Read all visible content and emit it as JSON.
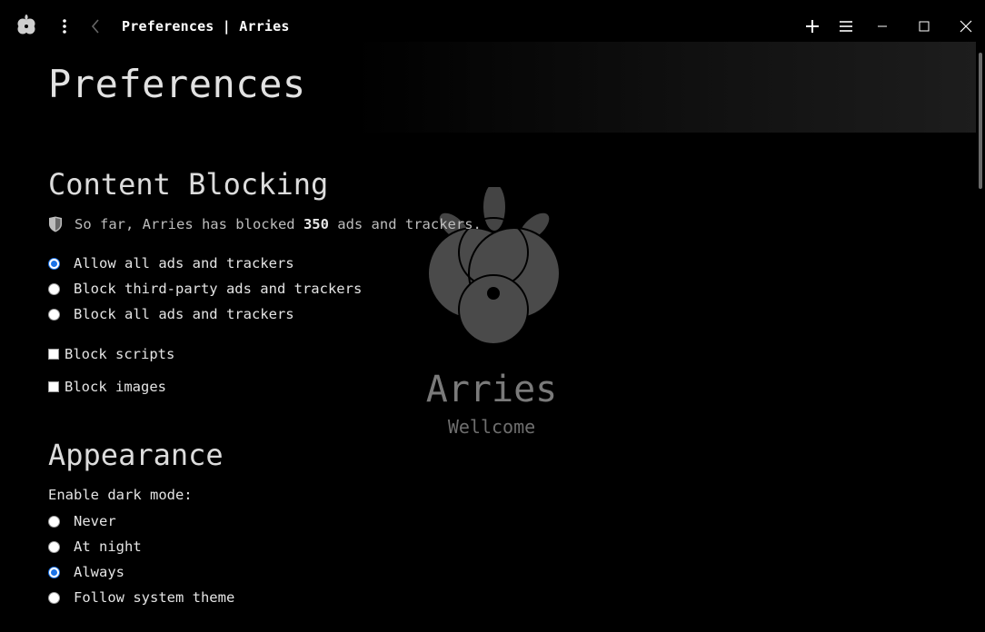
{
  "window": {
    "tab_title": "Preferences | Arries"
  },
  "toolbar": {
    "icons": [
      "app-logo-icon",
      "kebab-menu-icon",
      "back-icon",
      "plus-icon",
      "hamburger-menu-icon",
      "minimize-icon",
      "maximize-icon",
      "close-icon"
    ]
  },
  "page": {
    "title": "Preferences"
  },
  "watermark": {
    "name": "Arries",
    "subtitle": "Wellcome"
  },
  "content_blocking": {
    "heading": "Content Blocking",
    "stat_prefix": "So far, Arries has blocked",
    "stat_count": "350",
    "stat_suffix": "ads and trackers.",
    "options": [
      {
        "label": "Allow all ads and trackers",
        "checked": true
      },
      {
        "label": "Block third-party ads and trackers",
        "checked": false
      },
      {
        "label": "Block all ads and trackers",
        "checked": false
      }
    ],
    "block_scripts_label": "Block scripts",
    "block_images_label": "Block images"
  },
  "appearance": {
    "heading": "Appearance",
    "dark_mode_label": "Enable dark mode:",
    "options": [
      {
        "label": "Never",
        "checked": false
      },
      {
        "label": "At night",
        "checked": false
      },
      {
        "label": "Always",
        "checked": true
      },
      {
        "label": "Follow system theme",
        "checked": false
      }
    ]
  },
  "colors": {
    "background": "#000000",
    "accent": "#1a73e8",
    "text": "#e4e4e4"
  }
}
